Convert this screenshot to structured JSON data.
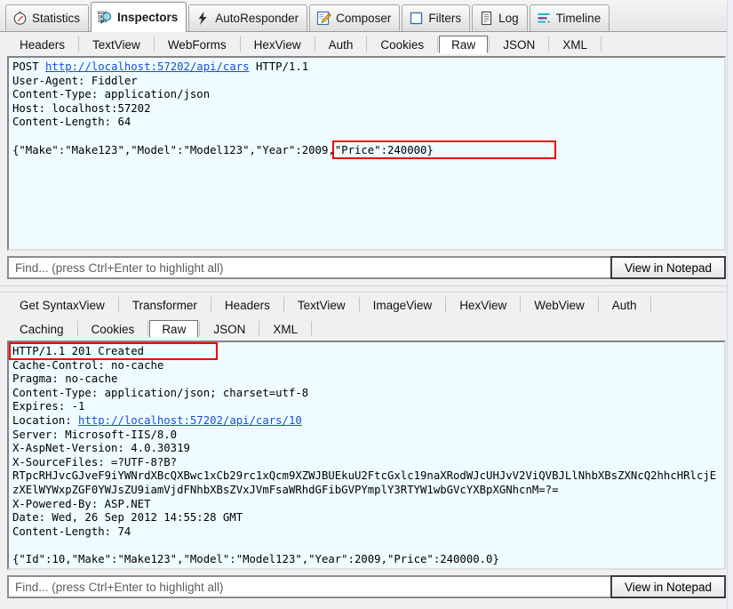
{
  "main_tabs": [
    {
      "label": "Statistics",
      "icon": "clock-icon",
      "active": false
    },
    {
      "label": "Inspectors",
      "icon": "binary-magnifier-icon",
      "active": true
    },
    {
      "label": "AutoResponder",
      "icon": "lightning-bolt-icon",
      "active": false
    },
    {
      "label": "Composer",
      "icon": "pencil-note-icon",
      "active": false
    },
    {
      "label": "Filters",
      "icon": "empty-square-icon",
      "active": false
    },
    {
      "label": "Log",
      "icon": "document-lines-icon",
      "active": false
    },
    {
      "label": "Timeline",
      "icon": "timeline-bars-icon",
      "active": false
    }
  ],
  "request": {
    "tabs": [
      {
        "label": "Headers",
        "selected": false
      },
      {
        "label": "TextView",
        "selected": false
      },
      {
        "label": "WebForms",
        "selected": false
      },
      {
        "label": "HexView",
        "selected": false
      },
      {
        "label": "Auth",
        "selected": false
      },
      {
        "label": "Cookies",
        "selected": false
      },
      {
        "label": "Raw",
        "selected": true
      },
      {
        "label": "JSON",
        "selected": false
      },
      {
        "label": "XML",
        "selected": false
      }
    ],
    "request_line_method": "POST ",
    "request_line_url": "http://localhost:57202/api/cars",
    "request_line_version": " HTTP/1.1",
    "headers": [
      "User-Agent: Fiddler",
      "Content-Type: application/json",
      "Host: localhost:57202",
      "Content-Length: 64"
    ],
    "body": "{\"Make\":\"Make123\",\"Model\":\"Model123\",\"Year\":2009,\"Price\":240000}",
    "highlight_text": "\"Year\":2009,\"Price\":240000",
    "find_placeholder": "Find... (press Ctrl+Enter to highlight all)",
    "notepad_button": "View in Notepad"
  },
  "response": {
    "tabs_row1": [
      {
        "label": "Get SyntaxView",
        "selected": false
      },
      {
        "label": "Transformer",
        "selected": false
      },
      {
        "label": "Headers",
        "selected": false
      },
      {
        "label": "TextView",
        "selected": false
      },
      {
        "label": "ImageView",
        "selected": false
      },
      {
        "label": "HexView",
        "selected": false
      },
      {
        "label": "WebView",
        "selected": false
      },
      {
        "label": "Auth",
        "selected": false
      }
    ],
    "tabs_row2": [
      {
        "label": "Caching",
        "selected": false
      },
      {
        "label": "Cookies",
        "selected": false
      },
      {
        "label": "Raw",
        "selected": true
      },
      {
        "label": "JSON",
        "selected": false
      },
      {
        "label": "XML",
        "selected": false
      }
    ],
    "status_line": "HTTP/1.1 201 Created",
    "headers_before_link": [
      "Cache-Control: no-cache",
      "Pragma: no-cache",
      "Content-Type: application/json; charset=utf-8",
      "Expires: -1"
    ],
    "location_label": "Location: ",
    "location_url": "http://localhost:57202/api/cars/10",
    "headers_after_link": [
      "Server: Microsoft-IIS/8.0",
      "X-AspNet-Version: 4.0.30319",
      "X-SourceFiles: =?UTF-8?B?",
      "RTpcRHJvcGJveF9iYWNrdXBcQXBwc1xCb29rc1xQcm9XZWJBUEkuU2FtcGxlc19naXRodWJcUHJvV2ViQVBJLlNhbXBsZXNcQ2hhcHRlcjEzXElWYWxpZGF0YWJsZU9iamVjdFNhbXBsZVxJVmFsaWRhdGFibGVPYmplY3RTYW1wbGVcYXBpXGNhcnM=?=",
      "X-Powered-By: ASP.NET",
      "Date: Wed, 26 Sep 2012 14:55:28 GMT",
      "Content-Length: 74"
    ],
    "body": "{\"Id\":10,\"Make\":\"Make123\",\"Model\":\"Model123\",\"Year\":2009,\"Price\":240000.0}",
    "find_placeholder": "Find... (press Ctrl+Enter to highlight all)",
    "notepad_button": "View in Notepad"
  },
  "colors": {
    "highlight_border": "#f20000",
    "link": "#1a4fd6",
    "viewer_bg": "#eefbff"
  }
}
